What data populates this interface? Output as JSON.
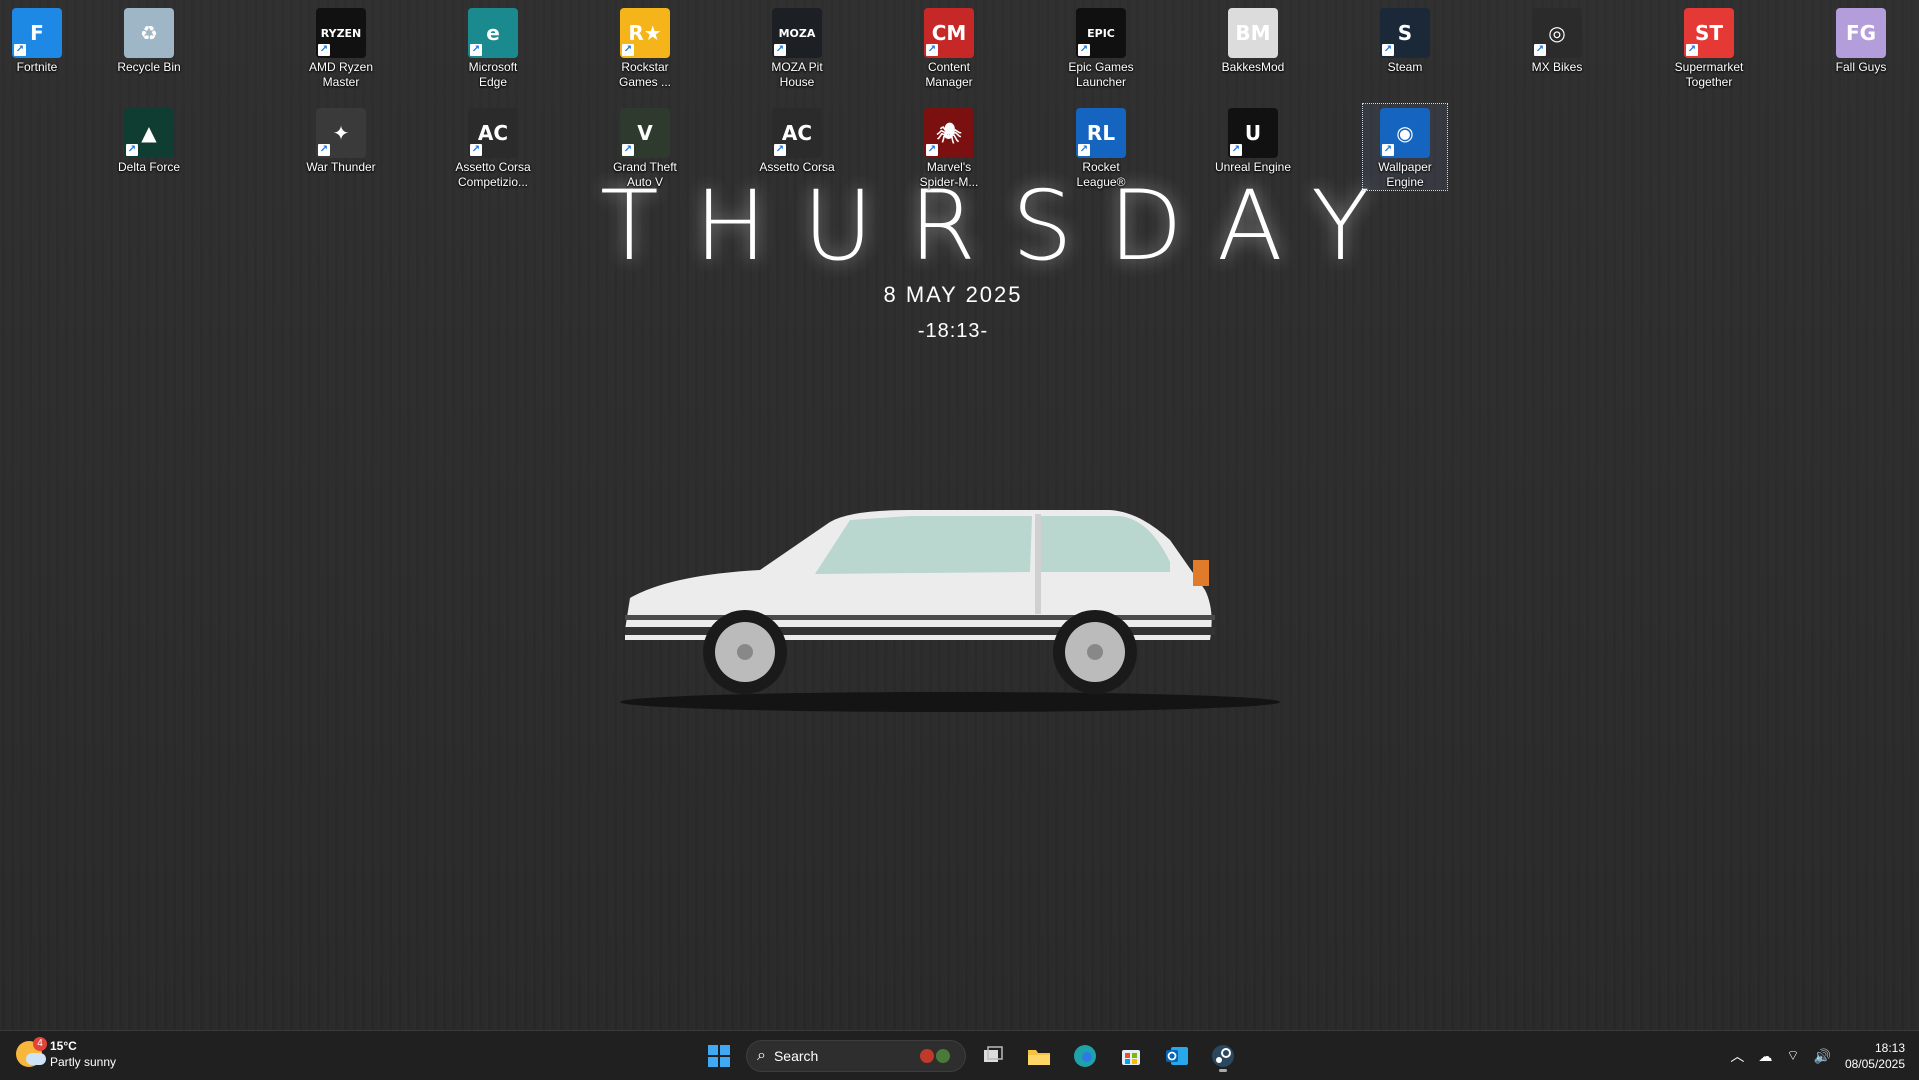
{
  "desktop": {
    "icons": [
      {
        "label": "Fortnite",
        "glyph": "F",
        "bg": "#1e88e5",
        "shortcut": true
      },
      {
        "label": "Recycle Bin",
        "glyph": "♻",
        "bg": "#9fb6c6",
        "shortcut": false
      },
      {
        "label": "AMD Ryzen Master",
        "glyph": "RYZEN",
        "bg": "#111111",
        "shortcut": true
      },
      {
        "label": "Microsoft Edge",
        "glyph": "e",
        "bg": "#1b8a8f",
        "shortcut": true
      },
      {
        "label": "Rockstar Games ...",
        "glyph": "R★",
        "bg": "#f4b41a",
        "shortcut": true
      },
      {
        "label": "MOZA Pit House",
        "glyph": "MOZA",
        "bg": "#1c2024",
        "shortcut": true
      },
      {
        "label": "Content Manager",
        "glyph": "CM",
        "bg": "#c62828",
        "shortcut": true
      },
      {
        "label": "Epic Games Launcher",
        "glyph": "EPIC",
        "bg": "#101010",
        "shortcut": true
      },
      {
        "label": "BakkesMod",
        "glyph": "BM",
        "bg": "#dcdcdc",
        "shortcut": false
      },
      {
        "label": "Steam",
        "glyph": "S",
        "bg": "#1b2838",
        "shortcut": true
      },
      {
        "label": "MX Bikes",
        "glyph": "◎",
        "bg": "#2b2b2b",
        "shortcut": true
      },
      {
        "label": "Supermarket Together",
        "glyph": "ST",
        "bg": "#e53935",
        "shortcut": true
      },
      {
        "label": "Fall Guys",
        "glyph": "FG",
        "bg": "#b39ddb",
        "shortcut": false
      },
      {
        "label": "Delta Force",
        "glyph": "▲",
        "bg": "#0f3d31",
        "shortcut": true
      },
      {
        "label": "War Thunder",
        "glyph": "✦",
        "bg": "#3a3a3a",
        "shortcut": true
      },
      {
        "label": "Assetto Corsa Competizio...",
        "glyph": "AC",
        "bg": "#2b2b2b",
        "shortcut": true
      },
      {
        "label": "Grand Theft Auto V",
        "glyph": "V",
        "bg": "#2d3a2d",
        "shortcut": true
      },
      {
        "label": "Assetto Corsa",
        "glyph": "AC",
        "bg": "#2b2b2b",
        "shortcut": true
      },
      {
        "label": "Marvel's Spider-M...",
        "glyph": "🕷",
        "bg": "#7b1010",
        "shortcut": true
      },
      {
        "label": "Rocket League®",
        "glyph": "RL",
        "bg": "#1565c0",
        "shortcut": true
      },
      {
        "label": "Unreal Engine",
        "glyph": "U",
        "bg": "#111111",
        "shortcut": true
      },
      {
        "label": "Wallpaper Engine",
        "glyph": "◉",
        "bg": "#1565c0",
        "shortcut": true
      }
    ]
  },
  "wallpaper": {
    "day": "THURSDAY",
    "date": "8 MAY 2025",
    "clock": "-18:13-"
  },
  "taskbar": {
    "weather": {
      "badge": "4",
      "temp": "15°C",
      "condition": "Partly sunny"
    },
    "search_label": "Search",
    "apps": [
      {
        "name": "start-button",
        "icon": "windows-icon",
        "running": false
      },
      {
        "name": "task-view-button",
        "icon": "task-view-icon",
        "running": false
      },
      {
        "name": "file-explorer-button",
        "icon": "folder-icon",
        "running": false
      },
      {
        "name": "edge-taskbar-button",
        "icon": "edge-icon",
        "running": false
      },
      {
        "name": "store-button",
        "icon": "store-icon",
        "running": false
      },
      {
        "name": "outlook-button",
        "icon": "outlook-icon",
        "running": false
      },
      {
        "name": "steam-taskbar-button",
        "icon": "steam-icon",
        "running": true
      }
    ],
    "tray": {
      "time": "18:13",
      "date": "08/05/2025"
    }
  }
}
